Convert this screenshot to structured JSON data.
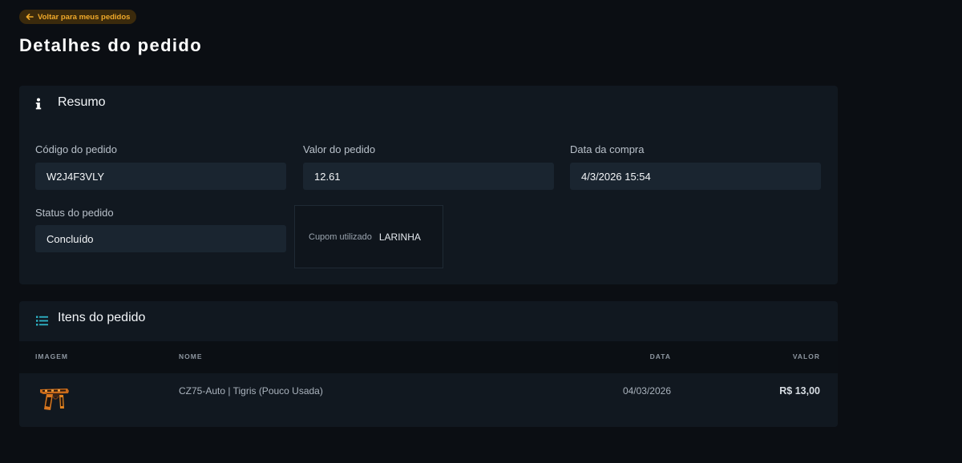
{
  "back_link": {
    "label": "Voltar para meus pedidos",
    "icon": "arrow-left-icon"
  },
  "page_title": "Detalhes do pedido",
  "summary": {
    "title": "Resumo",
    "icon": "info-icon",
    "fields": {
      "code": {
        "label": "Código do pedido",
        "value": "W2J4F3VLY"
      },
      "amount": {
        "label": "Valor do pedido",
        "value": "12.61"
      },
      "date": {
        "label": "Data da compra",
        "value": "4/3/2026 15:54"
      },
      "status": {
        "label": "Status do pedido",
        "value": "Concluído"
      }
    },
    "coupon": {
      "label": "Cupom utilizado",
      "value": "LARINHA"
    }
  },
  "items": {
    "title": "Itens do pedido",
    "icon": "list-icon",
    "columns": {
      "image": "IMAGEM",
      "name": "NOME",
      "date": "DATA",
      "price": "VALOR"
    },
    "rows": [
      {
        "image_icon": "pistol-icon",
        "name": "CZ75-Auto | Tigris (Pouco Usada)",
        "date": "04/03/2026",
        "price": "R$ 13,00"
      }
    ]
  },
  "colors": {
    "background": "#0b0e13",
    "card": "#111820",
    "field": "#1a2530",
    "accent": "#f0a92a",
    "list_icon": "#2fb6c9"
  }
}
